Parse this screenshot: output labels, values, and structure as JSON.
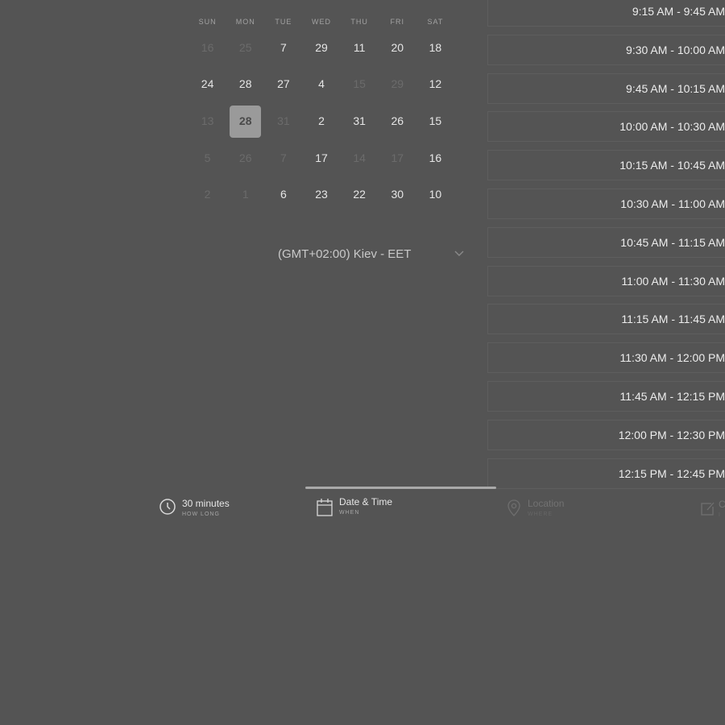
{
  "calendar": {
    "header": "",
    "weekdays": [
      "SUN",
      "MON",
      "TUE",
      "WED",
      "THU",
      "FRI",
      "SAT"
    ],
    "weeks": [
      [
        {
          "d": "16",
          "muted": true
        },
        {
          "d": "25",
          "muted": true
        },
        {
          "d": "7"
        },
        {
          "d": "29"
        },
        {
          "d": "11"
        },
        {
          "d": "20"
        },
        {
          "d": "18"
        }
      ],
      [
        {
          "d": "24"
        },
        {
          "d": "28"
        },
        {
          "d": "27"
        },
        {
          "d": "4"
        },
        {
          "d": "15",
          "muted": true
        },
        {
          "d": "29",
          "muted": true
        },
        {
          "d": "12"
        }
      ],
      [
        {
          "d": "13",
          "muted": true
        },
        {
          "d": "28",
          "selected": true
        },
        {
          "d": "31",
          "muted": true
        },
        {
          "d": "2"
        },
        {
          "d": "31"
        },
        {
          "d": "26"
        },
        {
          "d": "15"
        }
      ],
      [
        {
          "d": "5",
          "muted": true
        },
        {
          "d": "26",
          "muted": true
        },
        {
          "d": "7",
          "muted": true
        },
        {
          "d": "17"
        },
        {
          "d": "14",
          "muted": true
        },
        {
          "d": "17",
          "muted": true
        },
        {
          "d": "16"
        }
      ],
      [
        {
          "d": "2",
          "muted": true
        },
        {
          "d": "1",
          "muted": true
        },
        {
          "d": "6"
        },
        {
          "d": "23"
        },
        {
          "d": "22"
        },
        {
          "d": "30"
        },
        {
          "d": "10"
        }
      ]
    ]
  },
  "timezone": {
    "label": "(GMT+02:00) Kiev - EET",
    "icon": "chevron-down-icon"
  },
  "slots": [
    "9:15 AM - 9:45 AM",
    "9:30 AM - 10:00 AM",
    "9:45 AM - 10:15 AM",
    "10:00 AM - 10:30 AM",
    "10:15 AM - 10:45 AM",
    "10:30 AM - 11:00 AM",
    "10:45 AM - 11:15 AM",
    "11:00 AM - 11:30 AM",
    "11:15 AM - 11:45 AM",
    "11:30 AM - 12:00 PM",
    "11:45 AM - 12:15 PM",
    "12:00 PM - 12:30 PM",
    "12:15 PM - 12:45 PM"
  ],
  "steps": {
    "duration": {
      "title": "30 minutes",
      "subtitle": "HOW LONG",
      "icon": "clock-icon"
    },
    "datetime": {
      "title": "Date & Time",
      "subtitle": "WHEN",
      "icon": "calendar-icon"
    },
    "location": {
      "title": "Location",
      "subtitle": "WHERE",
      "icon": "location-pin-icon"
    },
    "details": {
      "title": "C",
      "subtitle": "I",
      "icon": "edit-icon"
    }
  },
  "colors": {
    "background": "#545454",
    "selected_day": "#9a9a9a",
    "progress": "#a9a9a9"
  }
}
